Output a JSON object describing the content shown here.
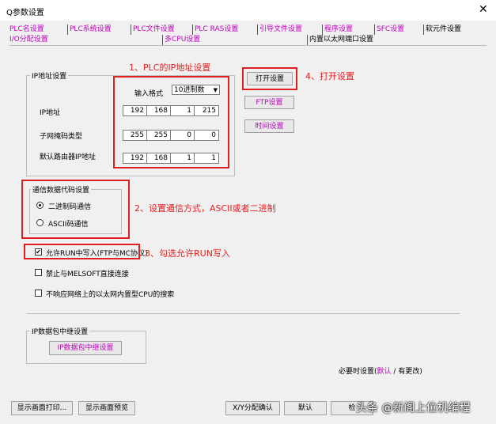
{
  "window": {
    "title": "Q参数设置",
    "close": "✕"
  },
  "tabs": {
    "row1": [
      "PLC名设置",
      "PLC系统设置",
      "PLC文件设置",
      "PLC RAS设置",
      "引导文件设置",
      "程序设置",
      "SFC设置",
      "软元件设置"
    ],
    "row2": [
      "I/O分配设置",
      "多CPU设置",
      "内置以太网端口设置"
    ]
  },
  "ip_settings": {
    "group_title": "IP地址设置",
    "input_format_label": "输入格式",
    "input_format_value": "10进制数",
    "ip_label": "IP地址",
    "ip_values": [
      "192",
      "168",
      "1",
      "215"
    ],
    "subnet_label": "子网掩码类型",
    "subnet_values": [
      "255",
      "255",
      "0",
      "0"
    ],
    "gateway_label": "默认路由器IP地址",
    "gateway_values": [
      "192",
      "168",
      "1",
      "1"
    ]
  },
  "buttons": {
    "open_settings": "打开设置",
    "ftp_settings": "FTP设置",
    "time_settings": "时间设置",
    "relay_settings": "IP数据包中继设置",
    "print_screen": "显示画面打印...",
    "preview_screen": "显示画面预览",
    "xy_confirm": "X/Y分配确认",
    "default": "默认",
    "check": "检"
  },
  "comm_code": {
    "group_title": "通信数据代码设置",
    "binary": "二进制码通信",
    "ascii": "ASCII码通信"
  },
  "checkboxes": {
    "run_write": "允许RUN中写入(FTP与MC协议)",
    "no_melsoft": "禁止与MELSOFT直接连接",
    "no_search": "不响应网络上的以太网内置型CPU的搜索"
  },
  "relay": {
    "group_title": "IP数据包中继设置"
  },
  "footer": {
    "required_prefix": "必要时设置(",
    "default_link": "默认",
    "slash": "/",
    "changed_link": "有更改",
    "suffix": ")"
  },
  "annotations": {
    "a1": "1、PLC的IP地址设置",
    "a2": "2、设置通信方式，ASCII或者二进制",
    "a3": "3、勾选允许RUN写入",
    "a4": "4、打开设置"
  },
  "watermark": "头条 @新阁上位机编程",
  "colors": {
    "tab_text": "#c000c0",
    "annotation": "#e02020"
  }
}
